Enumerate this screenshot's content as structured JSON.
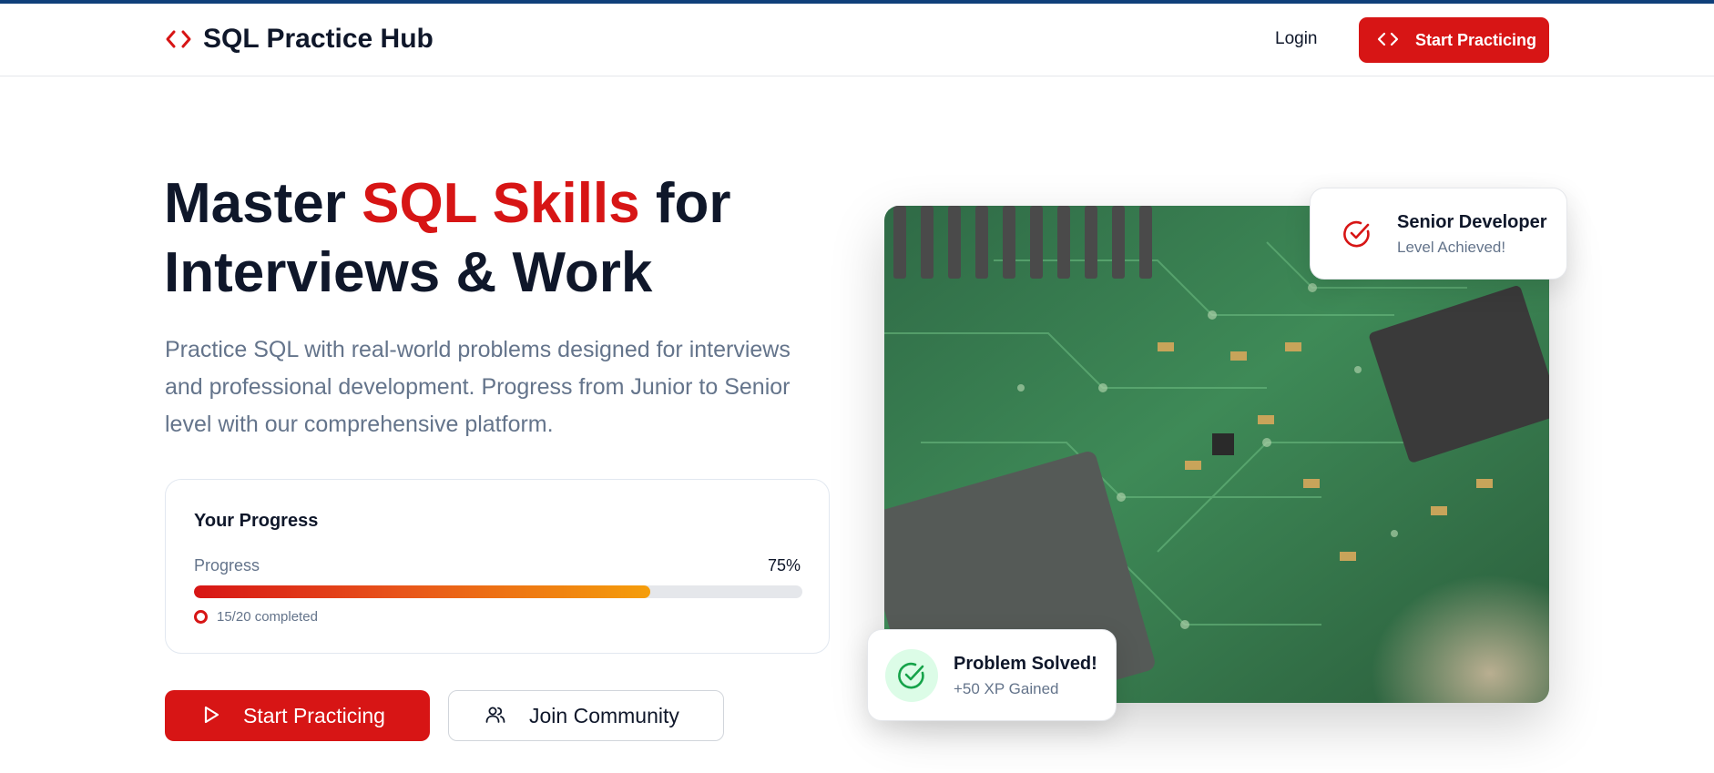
{
  "header": {
    "brand_name": "SQL Practice Hub",
    "login_label": "Login",
    "cta_label": "Start Practicing"
  },
  "hero": {
    "title_part1": "Master ",
    "title_accent": "SQL Skills",
    "title_part2": " for",
    "title_line2": "Interviews & Work",
    "description": "Practice SQL with real-world problems designed for interviews and professional development. Progress from Junior to Senior level with our comprehensive platform."
  },
  "progress_card": {
    "title": "Your Progress",
    "label": "Progress",
    "percent_text": "75%",
    "percent_value": 0.75,
    "status": "15/20 completed"
  },
  "buttons": {
    "primary_label": "Start Practicing",
    "secondary_label": "Join Community"
  },
  "badges": {
    "top_title": "Senior Developer",
    "top_subtitle": "Level Achieved!",
    "bottom_title": "Problem Solved!",
    "bottom_subtitle": "+50 XP Gained"
  },
  "icons": {
    "brand": "code-brackets-icon",
    "header_button": "code-brackets-icon",
    "primary_button": "play-icon",
    "secondary_button": "users-icon",
    "top_badge": "check-circle-icon",
    "bottom_badge": "check-circle-icon",
    "progress_status": "circle-dot-icon"
  },
  "colors": {
    "accent": "#d71515",
    "text_dark": "#0f172a",
    "text_muted": "#64748b",
    "success": "#16a34a",
    "success_bg": "#dcfce7",
    "progress_gradient_end": "#f59e0b"
  }
}
